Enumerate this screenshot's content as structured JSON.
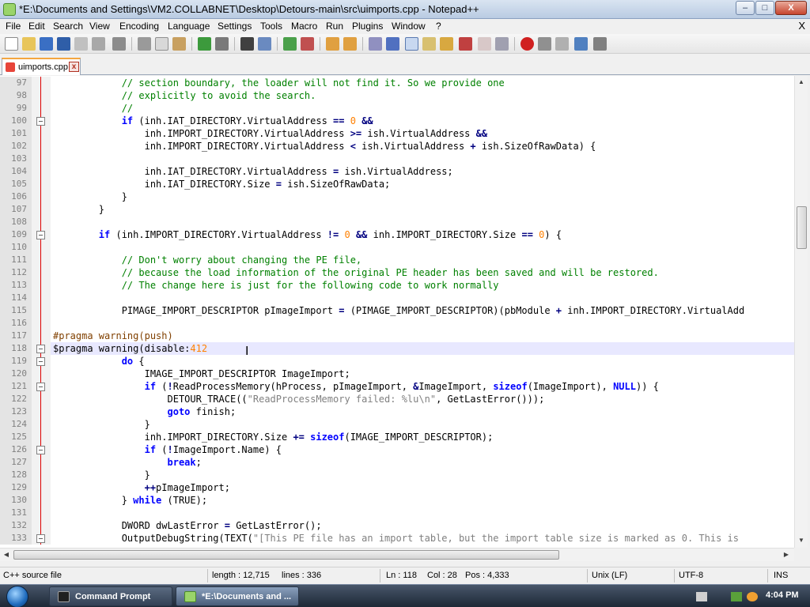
{
  "window": {
    "title": "*E:\\Documents and Settings\\VM2.COLLABNET\\Desktop\\Detours-main\\src\\uimports.cpp - Notepad++",
    "min_label": "–",
    "max_label": "□",
    "close_label": "X"
  },
  "menu": {
    "items": [
      "File",
      "Edit",
      "Search",
      "View",
      "Encoding",
      "Language",
      "Settings",
      "Tools",
      "Macro",
      "Run",
      "Plugins",
      "Window",
      "?"
    ],
    "close_doc": "X"
  },
  "toolbar": {
    "icons": [
      "new-file-icon",
      "open-file-icon",
      "save-icon",
      "save-all-icon",
      "close-icon",
      "close-all-icon",
      "print-icon",
      "cut-icon",
      "copy-icon",
      "paste-icon",
      "undo-icon",
      "redo-icon",
      "find-icon",
      "replace-icon",
      "zoom-in-icon",
      "zoom-out-icon",
      "sync-vertical-icon",
      "sync-horizontal-icon",
      "word-wrap-icon",
      "show-all-chars-icon",
      "indent-guide-icon",
      "user-language-icon",
      "document-map-icon",
      "function-list-icon",
      "folder-as-workspace-icon",
      "monitoring-icon",
      "record-macro-icon",
      "stop-record-icon",
      "play-macro-icon",
      "run-macro-multiple-icon",
      "save-macro-icon"
    ]
  },
  "tabs": [
    {
      "label": "uimports.cpp",
      "close": "x"
    }
  ],
  "editor": {
    "lines": [
      {
        "num": "97",
        "fold": "line",
        "tokens": [
          [
            "            ",
            ""
          ],
          [
            "// section boundary, the loader will not find it. So we provide one",
            "c"
          ]
        ]
      },
      {
        "num": "98",
        "fold": "line",
        "tokens": [
          [
            "            ",
            ""
          ],
          [
            "// explicitly to avoid the search.",
            "c"
          ]
        ]
      },
      {
        "num": "99",
        "fold": "line",
        "tokens": [
          [
            "            ",
            ""
          ],
          [
            "//",
            "c"
          ]
        ]
      },
      {
        "num": "100",
        "fold": "box",
        "tokens": [
          [
            "            ",
            ""
          ],
          [
            "if",
            "k"
          ],
          [
            " (inh.IAT_DIRECTORY.VirtualAddress ",
            ""
          ],
          [
            "==",
            "o"
          ],
          [
            " ",
            ""
          ],
          [
            "0",
            "n"
          ],
          [
            " ",
            ""
          ],
          [
            "&&",
            "o"
          ]
        ]
      },
      {
        "num": "101",
        "fold": "line",
        "tokens": [
          [
            "                inh.IMPORT_DIRECTORY.VirtualAddress ",
            ""
          ],
          [
            ">=",
            "o"
          ],
          [
            " ish.VirtualAddress ",
            ""
          ],
          [
            "&&",
            "o"
          ]
        ]
      },
      {
        "num": "102",
        "fold": "line",
        "tokens": [
          [
            "                inh.IMPORT_DIRECTORY.VirtualAddress ",
            ""
          ],
          [
            "<",
            "o"
          ],
          [
            " ish.VirtualAddress ",
            ""
          ],
          [
            "+",
            "o"
          ],
          [
            " ish.SizeOfRawData) {",
            ""
          ]
        ]
      },
      {
        "num": "103",
        "fold": "line",
        "tokens": [
          [
            "",
            ""
          ]
        ]
      },
      {
        "num": "104",
        "fold": "line",
        "tokens": [
          [
            "                inh.IAT_DIRECTORY.VirtualAddress ",
            ""
          ],
          [
            "=",
            "o"
          ],
          [
            " ish.VirtualAddress;",
            ""
          ]
        ]
      },
      {
        "num": "105",
        "fold": "line",
        "tokens": [
          [
            "                inh.IAT_DIRECTORY.Size ",
            ""
          ],
          [
            "=",
            "o"
          ],
          [
            " ish.SizeOfRawData;",
            ""
          ]
        ]
      },
      {
        "num": "106",
        "fold": "line",
        "tokens": [
          [
            "            }",
            ""
          ]
        ]
      },
      {
        "num": "107",
        "fold": "line",
        "tokens": [
          [
            "        }",
            ""
          ]
        ]
      },
      {
        "num": "108",
        "fold": "line",
        "tokens": [
          [
            "",
            ""
          ]
        ]
      },
      {
        "num": "109",
        "fold": "box",
        "tokens": [
          [
            "        ",
            ""
          ],
          [
            "if",
            "k"
          ],
          [
            " (inh.IMPORT_DIRECTORY.VirtualAddress ",
            ""
          ],
          [
            "!=",
            "o"
          ],
          [
            " ",
            ""
          ],
          [
            "0",
            "n"
          ],
          [
            " ",
            ""
          ],
          [
            "&&",
            "o"
          ],
          [
            " inh.IMPORT_DIRECTORY.Size ",
            ""
          ],
          [
            "==",
            "o"
          ],
          [
            " ",
            ""
          ],
          [
            "0",
            "n"
          ],
          [
            ") {",
            ""
          ]
        ]
      },
      {
        "num": "110",
        "fold": "line",
        "tokens": [
          [
            "",
            ""
          ]
        ]
      },
      {
        "num": "111",
        "fold": "line",
        "tokens": [
          [
            "            ",
            ""
          ],
          [
            "// Don't worry about changing the PE file,",
            "c"
          ]
        ]
      },
      {
        "num": "112",
        "fold": "line",
        "tokens": [
          [
            "            ",
            ""
          ],
          [
            "// because the load information of the original PE header has been saved and will be restored.",
            "c"
          ]
        ]
      },
      {
        "num": "113",
        "fold": "line",
        "tokens": [
          [
            "            ",
            ""
          ],
          [
            "// The change here is just for the following code to work normally",
            "c"
          ]
        ]
      },
      {
        "num": "114",
        "fold": "line",
        "tokens": [
          [
            "",
            ""
          ]
        ]
      },
      {
        "num": "115",
        "fold": "line",
        "tokens": [
          [
            "            PIMAGE_IMPORT_DESCRIPTOR pImageImport ",
            ""
          ],
          [
            "=",
            "o"
          ],
          [
            " (PIMAGE_IMPORT_DESCRIPTOR)(pbModule ",
            ""
          ],
          [
            "+",
            "o"
          ],
          [
            " inh.IMPORT_DIRECTORY.VirtualAdd",
            ""
          ]
        ]
      },
      {
        "num": "116",
        "fold": "line",
        "tokens": [
          [
            "",
            ""
          ]
        ]
      },
      {
        "num": "117",
        "fold": "line",
        "tokens": [
          [
            "#pragma warning(push)",
            "p"
          ]
        ]
      },
      {
        "num": "118",
        "fold": "box",
        "current": true,
        "tokens": [
          [
            "$pragma warning(disable:",
            ""
          ],
          [
            "412",
            "n"
          ]
        ]
      },
      {
        "num": "119",
        "fold": "box",
        "tokens": [
          [
            "            ",
            ""
          ],
          [
            "do",
            "k"
          ],
          [
            " {",
            ""
          ]
        ]
      },
      {
        "num": "120",
        "fold": "line",
        "tokens": [
          [
            "                IMAGE_IMPORT_DESCRIPTOR ImageImport;",
            ""
          ]
        ]
      },
      {
        "num": "121",
        "fold": "box",
        "tokens": [
          [
            "                ",
            ""
          ],
          [
            "if",
            "k"
          ],
          [
            " (",
            ""
          ],
          [
            "!",
            "o"
          ],
          [
            "ReadProcessMemory(hProcess, pImageImport, ",
            ""
          ],
          [
            "&",
            "o"
          ],
          [
            "ImageImport, ",
            ""
          ],
          [
            "sizeof",
            "k"
          ],
          [
            "(ImageImport), ",
            ""
          ],
          [
            "NULL",
            "k"
          ],
          [
            ")) {",
            ""
          ]
        ]
      },
      {
        "num": "122",
        "fold": "line",
        "tokens": [
          [
            "                    DETOUR_TRACE((",
            ""
          ],
          [
            "\"ReadProcessMemory failed: %lu\\n\"",
            "s"
          ],
          [
            ", GetLastError()));",
            ""
          ]
        ]
      },
      {
        "num": "123",
        "fold": "line",
        "tokens": [
          [
            "                    ",
            ""
          ],
          [
            "goto",
            "k"
          ],
          [
            " finish;",
            ""
          ]
        ]
      },
      {
        "num": "124",
        "fold": "line",
        "tokens": [
          [
            "                }",
            ""
          ]
        ]
      },
      {
        "num": "125",
        "fold": "line",
        "tokens": [
          [
            "                inh.IMPORT_DIRECTORY.Size ",
            ""
          ],
          [
            "+=",
            "o"
          ],
          [
            " ",
            ""
          ],
          [
            "sizeof",
            "k"
          ],
          [
            "(IMAGE_IMPORT_DESCRIPTOR);",
            ""
          ]
        ]
      },
      {
        "num": "126",
        "fold": "box",
        "tokens": [
          [
            "                ",
            ""
          ],
          [
            "if",
            "k"
          ],
          [
            " (",
            ""
          ],
          [
            "!",
            "o"
          ],
          [
            "ImageImport.Name) {",
            ""
          ]
        ]
      },
      {
        "num": "127",
        "fold": "line",
        "tokens": [
          [
            "                    ",
            ""
          ],
          [
            "break",
            "k"
          ],
          [
            ";",
            ""
          ]
        ]
      },
      {
        "num": "128",
        "fold": "line",
        "tokens": [
          [
            "                }",
            ""
          ]
        ]
      },
      {
        "num": "129",
        "fold": "line",
        "tokens": [
          [
            "                ",
            ""
          ],
          [
            "++",
            "o"
          ],
          [
            "pImageImport;",
            ""
          ]
        ]
      },
      {
        "num": "130",
        "fold": "line",
        "tokens": [
          [
            "            } ",
            ""
          ],
          [
            "while",
            "k"
          ],
          [
            " (TRUE);",
            ""
          ]
        ]
      },
      {
        "num": "131",
        "fold": "line",
        "tokens": [
          [
            "",
            ""
          ]
        ]
      },
      {
        "num": "132",
        "fold": "line",
        "tokens": [
          [
            "            DWORD dwLastError ",
            ""
          ],
          [
            "=",
            "o"
          ],
          [
            " GetLastError();",
            ""
          ]
        ]
      },
      {
        "num": "133",
        "fold": "box",
        "tokens": [
          [
            "            OutputDebugString(TEXT(",
            ""
          ],
          [
            "\"[This PE file has an import table, but the import table size is marked as 0. This is",
            "s"
          ]
        ]
      }
    ]
  },
  "status": {
    "file_type": "C++ source file",
    "length": "length : 12,715",
    "lines": "lines : 336",
    "ln": "Ln : 118",
    "col": "Col : 28",
    "pos": "Pos : 4,333",
    "eol": "Unix (LF)",
    "encoding": "UTF-8",
    "mode": "INS"
  },
  "taskbar": {
    "buttons": [
      {
        "label": "Command Prompt"
      },
      {
        "label": "*E:\\Documents and ..."
      }
    ],
    "clock": "4:04 PM"
  },
  "colors": {
    "comment": "#008000",
    "keyword": "#0000ff",
    "number": "#ff8000",
    "string": "#808080",
    "preprocessor": "#804000",
    "current_line": "#e8e8ff"
  }
}
